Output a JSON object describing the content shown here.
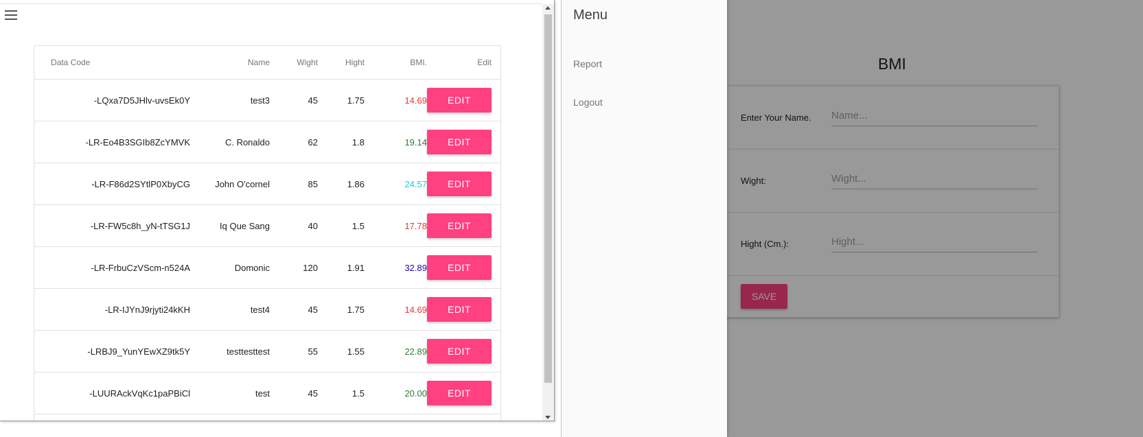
{
  "table": {
    "headers": {
      "code": "Data Code",
      "name": "Name",
      "weight": "Wight",
      "height": "Hight",
      "bmi": "BMI.",
      "edit": "Edit"
    },
    "edit_label": "EDIT",
    "rows": [
      {
        "code": "-LQxa7D5JHlv-uvsEk0Y",
        "name": "test3",
        "weight": "45",
        "height": "1.75",
        "bmi": "14.69",
        "bmi_color": "#e53935"
      },
      {
        "code": "-LR-Eo4B3SGIb8ZcYMVK",
        "name": "C. Ronaldo",
        "weight": "62",
        "height": "1.8",
        "bmi": "19.14",
        "bmi_color": "#2e7d32"
      },
      {
        "code": "-LR-F86d2SYtlP0XbyCG",
        "name": "John O'cornel",
        "weight": "85",
        "height": "1.86",
        "bmi": "24.57",
        "bmi_color": "#26c6da"
      },
      {
        "code": "-LR-FW5c8h_yN-tTSG1J",
        "name": "Iq Que Sang",
        "weight": "40",
        "height": "1.5",
        "bmi": "17.78",
        "bmi_color": "#e53935"
      },
      {
        "code": "-LR-FrbuCzVScm-n524A",
        "name": "Domonic",
        "weight": "120",
        "height": "1.91",
        "bmi": "32.89",
        "bmi_color": "#1a0dab"
      },
      {
        "code": "-LR-IJYnJ9rjyti24kKH",
        "name": "test4",
        "weight": "45",
        "height": "1.75",
        "bmi": "14.69",
        "bmi_color": "#e53935"
      },
      {
        "code": "-LRBJ9_YunYEwXZ9tk5Y",
        "name": "testtesttest",
        "weight": "55",
        "height": "1.55",
        "bmi": "22.89",
        "bmi_color": "#2e7d32"
      },
      {
        "code": "-LUURAckVqKc1paPBiCl",
        "name": "test",
        "weight": "45",
        "height": "1.5",
        "bmi": "20.00",
        "bmi_color": "#2e7d32"
      }
    ]
  },
  "drawer": {
    "title": "Menu",
    "items": [
      {
        "label": "Report"
      },
      {
        "label": "Logout"
      }
    ]
  },
  "form": {
    "title": "BMI",
    "name_label": "Enter Your Name.",
    "name_placeholder": "Name...",
    "weight_label": "Wight:",
    "weight_placeholder": "Wight...",
    "height_label": "Hight (Cm.):",
    "height_placeholder": "Hight...",
    "save_label": "SAVE"
  },
  "colors": {
    "accent": "#ff4081",
    "overlay": "rgba(0,0,0,0.4)"
  }
}
